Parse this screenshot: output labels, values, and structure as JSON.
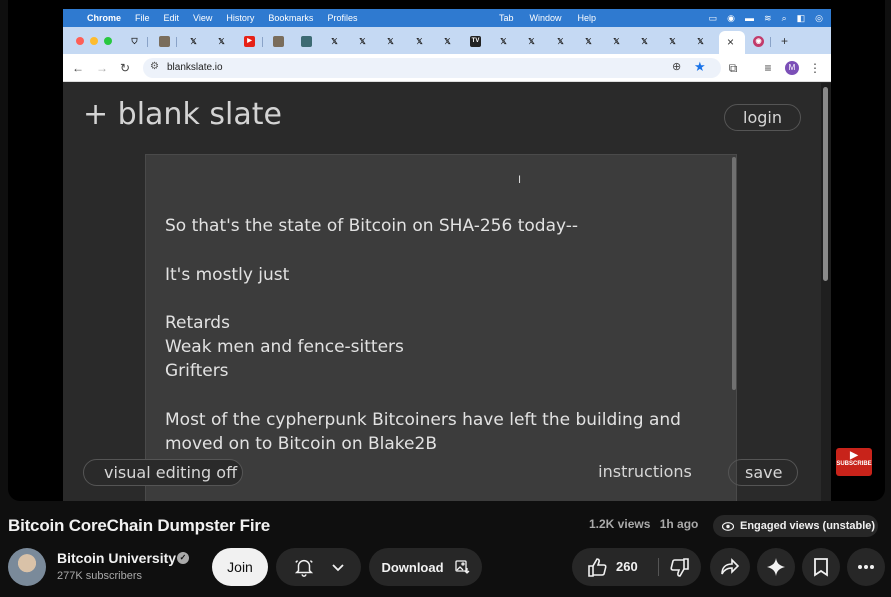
{
  "macos": {
    "menubar": {
      "app_name": "Chrome",
      "left_menus": [
        "File",
        "Edit",
        "View",
        "History",
        "Bookmarks",
        "Profiles"
      ],
      "right_menus": [
        "Tab",
        "Window",
        "Help"
      ]
    }
  },
  "browser": {
    "url": "blankslate.io",
    "profile_initial": "M",
    "new_tab_symbol": "+",
    "close_tab_symbol": "×"
  },
  "site": {
    "logo": "+ blank slate",
    "login_label": "login",
    "visual_editing_label": "visual editing off",
    "instructions_label": "instructions",
    "save_label": "save",
    "editor_lines": [
      "So that's the state of Bitcoin on SHA-256 today--",
      "",
      "It's mostly just",
      "",
      "Retards",
      "Weak men and fence-sitters",
      "Grifters",
      "",
      "Most of the cypherpunk Bitcoiners have left the building and",
      "moved on to Bitcoin on Blake2B"
    ]
  },
  "watermark": {
    "label": "SUBSCRIBE"
  },
  "video": {
    "title": "Bitcoin CoreChain Dumpster Fire",
    "views": "1.2K views",
    "age": "1h ago",
    "engaged_label": "Engaged views (unstable)"
  },
  "channel": {
    "name": "Bitcoin University",
    "subscribers": "277K subscribers"
  },
  "actions": {
    "join_label": "Join",
    "download_label": "Download",
    "like_count": "260"
  },
  "colors": {
    "menubar_bg": "#2f7ad0",
    "tabstrip_bg": "#c5d9f3",
    "page_bg": "#2a2a2a",
    "editor_bg": "#3c3c3c",
    "youtube_bg": "#0f0f0f",
    "button_bg": "#272727"
  }
}
